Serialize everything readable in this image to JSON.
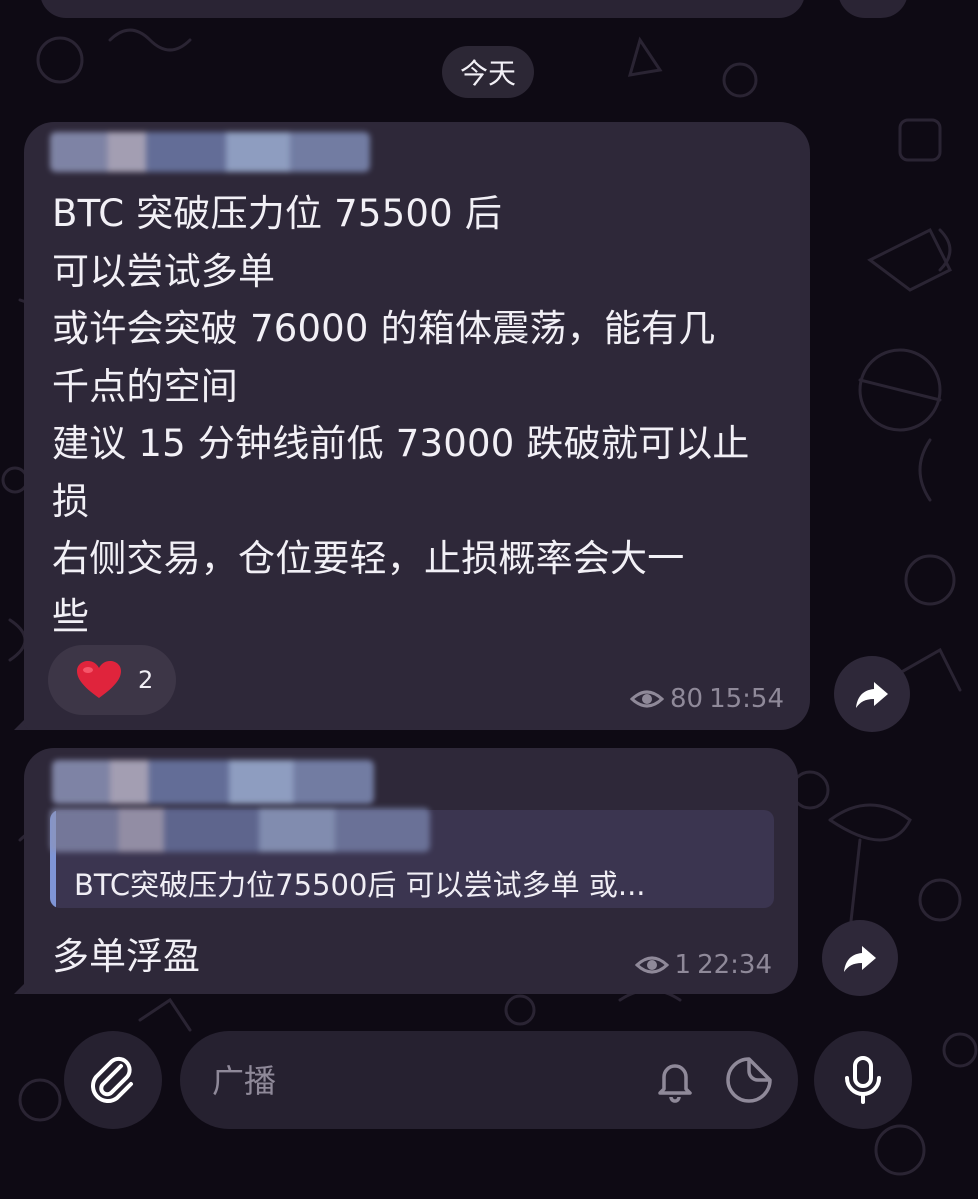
{
  "chat": {
    "date_label": "今天",
    "message_1": {
      "text": "BTC 突破压力位 75500 后\n可以尝试多单\n或许会突破 76000 的箱体震荡，能有几\n千点的空间\n建议 15 分钟线前低 73000 跌破就可以止\n损\n右侧交易，仓位要轻，止损概率会大一\n些",
      "reaction_emoji": "heart-icon",
      "reaction_count": "2",
      "views": "80",
      "time": "15:54"
    },
    "message_2": {
      "quote_text": "BTC突破压力位75500后 可以尝试多单 或...",
      "text": "多单浮盈",
      "views": "1",
      "time": "22:34"
    }
  },
  "composer": {
    "placeholder": "广播"
  },
  "colors": {
    "background": "#0e0a14",
    "bubble": "#2e2839",
    "accent": "#7f95d6",
    "heart": "#e0243c"
  }
}
